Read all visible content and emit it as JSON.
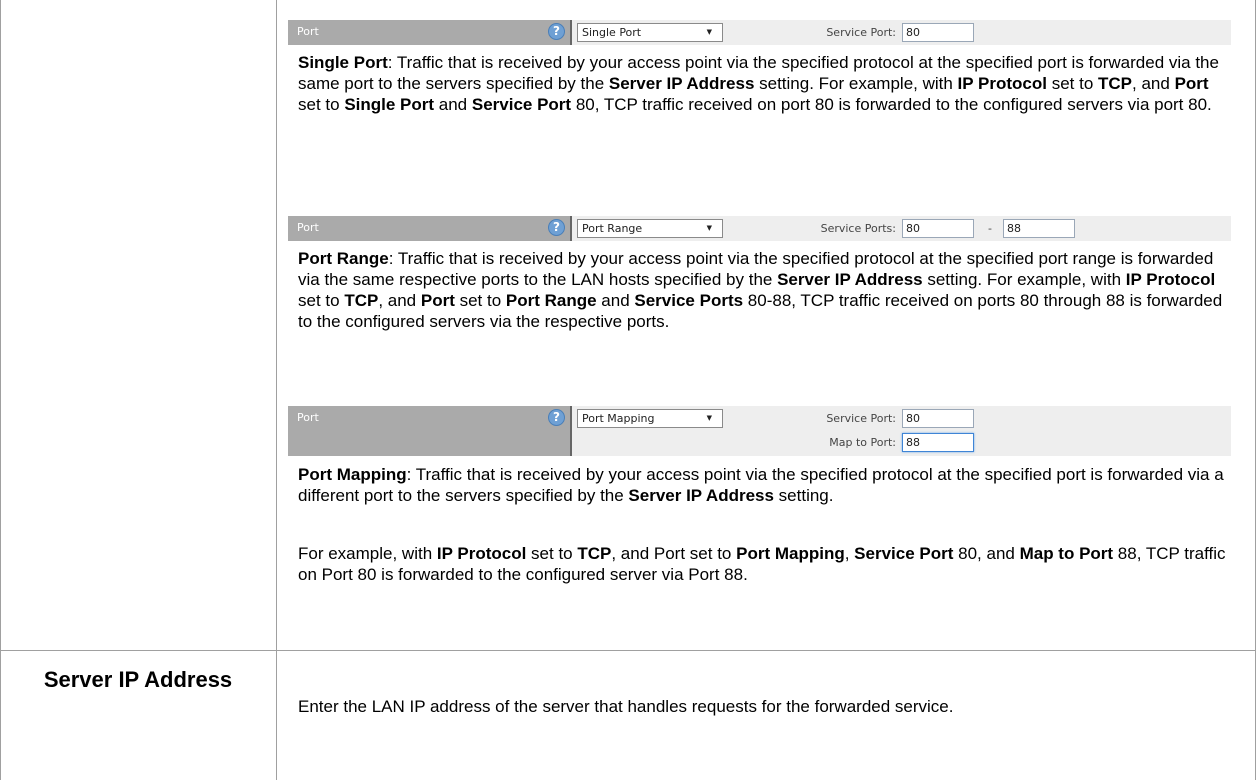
{
  "widgets": {
    "single": {
      "label": "Port",
      "help": "?",
      "select_value": "Single Port",
      "service_port_label": "Service Port:",
      "service_port_value": "80"
    },
    "range": {
      "label": "Port",
      "help": "?",
      "select_value": "Port Range",
      "service_ports_label": "Service Ports:",
      "from_value": "80",
      "separator": "-",
      "to_value": "88"
    },
    "mapping": {
      "label": "Port",
      "help": "?",
      "select_value": "Port Mapping",
      "service_port_label": "Service Port:",
      "service_port_value": "80",
      "map_to_label": "Map to Port:",
      "map_to_value": "88"
    }
  },
  "desc": {
    "single": {
      "t1": "Single Port",
      "t2": ": Traffic that is received by your access point via the specified protocol at the specified port is forwarded via the same port to the servers specified by the ",
      "t3": "Server IP Address",
      "t4": " setting. For example, with ",
      "t5": "IP Protocol",
      "t6": " set to ",
      "t7": "TCP",
      "t8": ", and ",
      "t9": "Port",
      "t10": " set to ",
      "t11": "Single Port",
      "t12": " and ",
      "t13": "Service Port",
      "t14": " 80, TCP traffic received on port 80 is forwarded to the configured servers via port 80."
    },
    "range": {
      "t1": "Port Range",
      "t2": ": Traffic that is received by your access point via the specified protocol at the specified port range is forwarded via the same respective ports to the LAN hosts specified by the ",
      "t3": "Server IP Address",
      "t4": " setting. For example, with ",
      "t5": "IP Protocol",
      "t6": " set to ",
      "t7": "TCP",
      "t8": ", and ",
      "t9": "Port",
      "t10": " set to ",
      "t11": "Port Range",
      "t12": " and ",
      "t13": "Service Ports",
      "t14": " 80-88, TCP traffic received on ports 80 through 88 is forwarded to the configured servers via the respective ports."
    },
    "mapping": {
      "t1": "Port Mapping",
      "t2": ": Traffic that is received by your access point via the specified protocol at the specified port is forwarded via a different port to the servers specified by the ",
      "t3": "Server IP Address",
      "t4": " setting."
    },
    "mapping_example": {
      "t1": "For example, with ",
      "t2": "IP Protocol",
      "t3": " set to ",
      "t4": "TCP",
      "t5": ", and Port set to ",
      "t6": "Port Mapping",
      "t7": ", ",
      "t8": "Service Port",
      "t9": " 80, and ",
      "t10": "Map to Port",
      "t11": " 88, TCP traffic on Port 80 is forwarded to the configured server via Port 88."
    }
  },
  "server_ip": {
    "name": "Server IP Address",
    "description": "Enter the LAN IP address of the server that handles requests for the forwarded service."
  }
}
